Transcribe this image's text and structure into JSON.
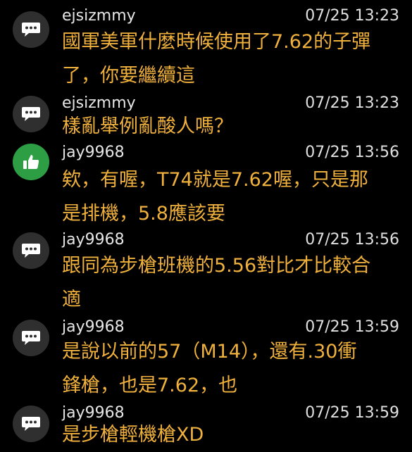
{
  "comments": [
    {
      "user": "ejsizmmy",
      "time": "07/25 13:23",
      "icon": "chat-bubble-icon",
      "text": "國軍美軍什麼時候使用了7.62的子彈\n了，你要繼續這"
    },
    {
      "user": "ejsizmmy",
      "time": "07/25 13:23",
      "icon": "chat-bubble-icon",
      "text": "樣亂舉例亂酸人嗎？"
    },
    {
      "user": "jay9968",
      "time": "07/25 13:56",
      "icon": "thumbs-up-icon",
      "text": "欸，有喔，T74就是7.62喔，只是那\n是排機，5.8應該要"
    },
    {
      "user": "jay9968",
      "time": "07/25 13:56",
      "icon": "chat-bubble-icon",
      "text": "跟同為步槍班機的5.56對比才比較合\n適"
    },
    {
      "user": "jay9968",
      "time": "07/25 13:59",
      "icon": "chat-bubble-icon",
      "text": "是說以前的57（M14），還有.30衝\n鋒槍，也是7.62，也"
    },
    {
      "user": "jay9968",
      "time": "07/25 13:59",
      "icon": "chat-bubble-icon",
      "text": "是步槍輕機槍XD"
    }
  ],
  "colors": {
    "background": "#000000",
    "comment_text": "#f0b13c",
    "username": "#e6e6e6",
    "chat_avatar": "#2f2f2f",
    "like_avatar": "#2e9e45"
  }
}
